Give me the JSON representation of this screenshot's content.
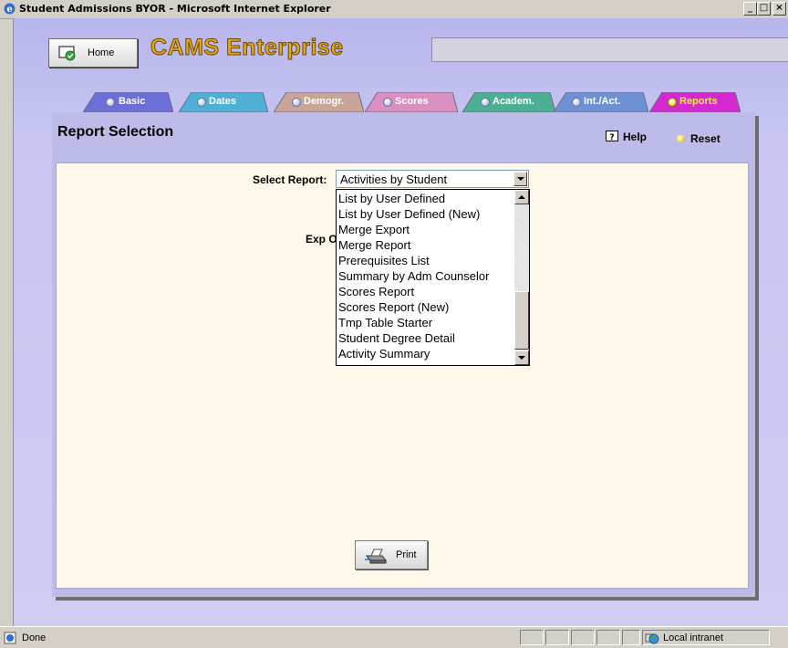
{
  "window": {
    "title": "Student Admissions BYOR - Microsoft Internet Explorer",
    "controls": [
      "_",
      "□",
      "×"
    ]
  },
  "header": {
    "home_label": "Home",
    "brand": "CAMS Enterprise"
  },
  "tabs": [
    {
      "label": "Basic",
      "color": "#6d6ed6",
      "active": false
    },
    {
      "label": "Dates",
      "color": "#4fb0d6",
      "active": false
    },
    {
      "label": "Demogr.",
      "color": "#c8a598",
      "active": false
    },
    {
      "label": "Scores",
      "color": "#d98fbf",
      "active": false
    },
    {
      "label": "Academ.",
      "color": "#4cae92",
      "active": false
    },
    {
      "label": "Int./Act.",
      "color": "#6e90d4",
      "active": false
    },
    {
      "label": "Reports",
      "color": "#d429d1",
      "active": true
    }
  ],
  "panel": {
    "title": "Report Selection",
    "help_label": "Help",
    "reset_label": "Reset"
  },
  "form": {
    "select_label": "Select Report:",
    "selected_value": "Activities by Student",
    "export_label_partial": "Exp O",
    "options": [
      "List by User Defined",
      "List by User Defined (New)",
      "Merge Export",
      "Merge Report",
      "Prerequisites List",
      "Summary by Adm Counselor",
      "Scores Report",
      "Scores Report (New)",
      "Tmp Table Starter",
      "Student Degree Detail",
      "Activity Summary"
    ],
    "print_label": "Print"
  },
  "status_bar": {
    "text": "Done",
    "zone": "Local intranet"
  }
}
